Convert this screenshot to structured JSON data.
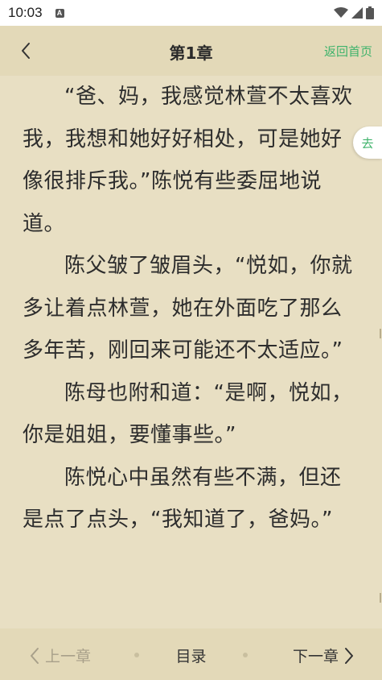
{
  "status_bar": {
    "time": "10:03",
    "notification_icon": "a-badge-icon",
    "icons": [
      "wifi-icon",
      "signal-icon",
      "battery-icon"
    ]
  },
  "header": {
    "title": "第1章",
    "home_label": "返回首页",
    "back_icon": "chevron-left-icon"
  },
  "content": {
    "paragraphs": [
      "“爸、妈，我感觉林萱不太喜欢我，我想和她好好相处，可是她好像很排斥我。”陈悦有些委屈地说道。",
      "陈父皱了皱眉头，“悦如，你就多让着点林萱，她在外面吃了那么多年苦，刚回来可能还不太适应。”",
      "陈母也附和道：“是啊，悦如，你是姐姐，要懂事些。”",
      "陈悦心中虽然有些不满，但还是点了点头，“我知道了，爸妈。”"
    ]
  },
  "float_button": {
    "label": "去"
  },
  "bottom_nav": {
    "prev_label": "上一章",
    "toc_label": "目录",
    "next_label": "下一章"
  },
  "colors": {
    "page_bg": "#e8dfc3",
    "bar_bg": "#e3d9b8",
    "accent": "#3fb36b",
    "text": "#2d2d2d",
    "disabled": "#a8a08a"
  }
}
